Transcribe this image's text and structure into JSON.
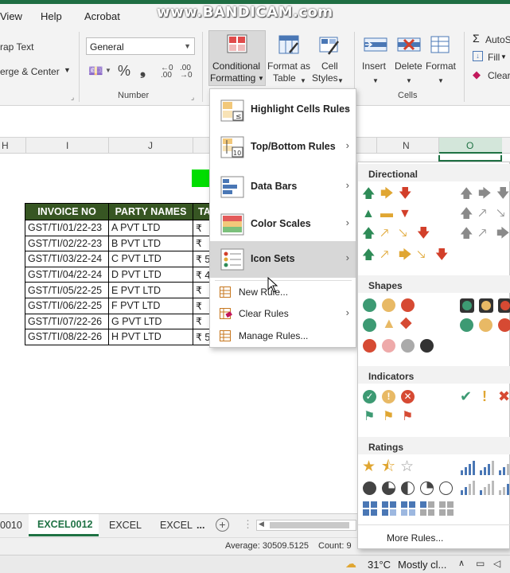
{
  "watermark": "www.BANDICAM.com",
  "tabs": [
    "View",
    "Help",
    "Acrobat"
  ],
  "ribbon": {
    "wrap_text": "rap Text",
    "merge_center": "erge & Center",
    "number_format": "General",
    "number_group": "Number",
    "conditional_formatting_1": "Conditional",
    "conditional_formatting_2": "Formatting",
    "format_as_table_1": "Format as",
    "format_as_table_2": "Table",
    "cell_styles_1": "Cell",
    "cell_styles_2": "Styles",
    "insert": "Insert",
    "delete": "Delete",
    "format": "Format",
    "cells_group": "Cells",
    "autosum": "AutoS",
    "fill": "Fill",
    "clear": "Clear"
  },
  "columns": [
    "H",
    "I",
    "J",
    "N",
    "O"
  ],
  "table": {
    "headers": [
      "INVOICE NO",
      "PARTY NAMES",
      "TA"
    ],
    "rows": [
      {
        "invoice": "GST/TI/01/22-23",
        "party": "A PVT LTD",
        "amt": "₹"
      },
      {
        "invoice": "GST/TI/02/22-23",
        "party": "B PVT LTD",
        "amt": "₹"
      },
      {
        "invoice": "GST/TI/03/22-24",
        "party": "C PVT LTD",
        "amt": "₹ 5"
      },
      {
        "invoice": "GST/TI/04/22-24",
        "party": "D PVT LTD",
        "amt": "₹ 4"
      },
      {
        "invoice": "GST/TI/05/22-25",
        "party": "E PVT LTD",
        "amt": "₹"
      },
      {
        "invoice": "GST/TI/06/22-25",
        "party": "F PVT LTD",
        "amt": "₹"
      },
      {
        "invoice": "GST/TI/07/22-26",
        "party": "G PVT LTD",
        "amt": "₹"
      },
      {
        "invoice": "GST/TI/08/22-26",
        "party": "H PVT LTD",
        "amt": "₹ 5"
      }
    ]
  },
  "cf_menu": {
    "highlight": "Highlight Cells Rules",
    "topbottom": "Top/Bottom Rules",
    "databars": "Data Bars",
    "colorscales": "Color Scales",
    "iconsets": "Icon Sets",
    "newrule": "New Rule...",
    "clearrules": "Clear Rules",
    "managerules": "Manage Rules...",
    "tb_badge": "10"
  },
  "icon_menu": {
    "directional": "Directional",
    "shapes": "Shapes",
    "indicators": "Indicators",
    "ratings": "Ratings",
    "more_rules": "More Rules..."
  },
  "sheets": {
    "partial": "0010",
    "active": "EXCEL0012",
    "tab2": "EXCEL",
    "tab3": "EXCEL",
    "more": "..."
  },
  "status": {
    "average": "Average: 30509.5125",
    "count": "Count: 9"
  },
  "taskbar": {
    "weather": "31°C",
    "condition": "Mostly cl..."
  },
  "colors": {
    "green": "#2e8b57",
    "amber": "#e0a632",
    "red": "#d23f2a",
    "header_green": "#375623"
  }
}
